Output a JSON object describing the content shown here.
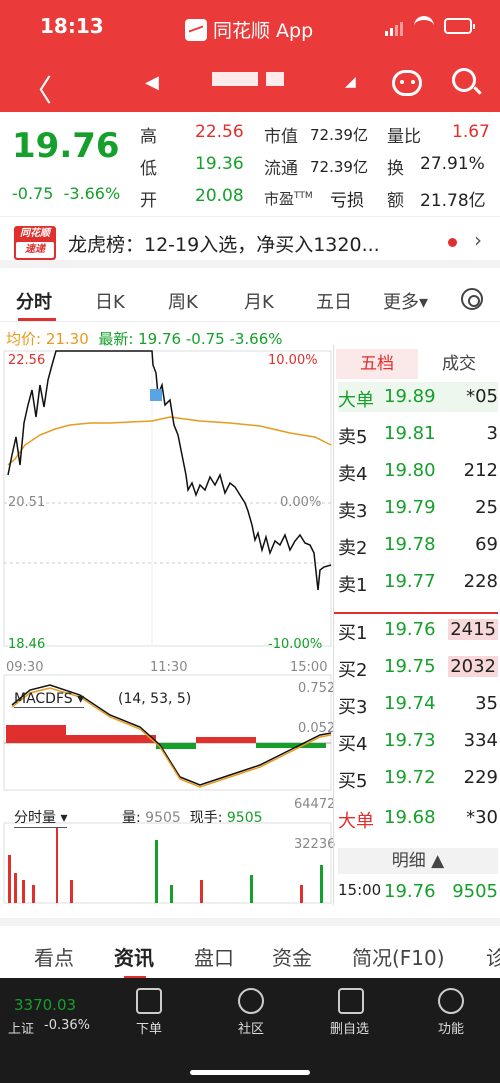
{
  "status": {
    "time": "18:13",
    "app": "同花顺 App"
  },
  "nav": {
    "back": "〈",
    "search": "search"
  },
  "quote": {
    "price": "19.76",
    "change": "-0.75",
    "pct": "-3.66%",
    "high_label": "高",
    "high": "22.56",
    "low_label": "低",
    "low": "19.36",
    "open_label": "开",
    "open": "20.08",
    "mktcap_label": "市值",
    "mktcap": "72.39亿",
    "float_label": "流通",
    "float": "72.39亿",
    "pe_label": "市盈",
    "pe_sup": "TTM",
    "pe": "亏损",
    "vr_label": "量比",
    "vr": "1.67",
    "turn_label": "换",
    "turn": "27.91%",
    "amt_label": "额",
    "amt": "21.78亿"
  },
  "news": {
    "logo_top": "同花顺",
    "logo_bottom": "速递",
    "text": "龙虎榜：12-19入选，净买入1320...",
    "arrow": "›"
  },
  "tabs": [
    "分时",
    "日K",
    "周K",
    "月K",
    "五日",
    "更多▾"
  ],
  "chart": {
    "avg_label": "均价: 21.30",
    "latest_label": "最新: 19.76",
    "chg": "-0.75",
    "pct": "-3.66%",
    "y_high": "22.56",
    "y_mid": "20.51",
    "y_low": "18.46",
    "pct_high": "10.00%",
    "pct_mid": "0.00%",
    "pct_low": "-10.00%",
    "times": [
      "09:30",
      "11:30",
      "15:00"
    ],
    "macd_name": "MACDFS ▾",
    "macd_params": "(14, 53, 5)",
    "macd_top": "0.752",
    "macd_mid": "0.052",
    "vol_name": "分时量 ▾",
    "vol_label": "量:",
    "vol_value": "9505",
    "now_label": "现手:",
    "now_value": "9505",
    "vol_top": "64472",
    "vol_mid": "32236"
  },
  "orderbook": {
    "tab1": "五档",
    "tab2": "成交",
    "rows": [
      {
        "l": "大单",
        "p": "19.89",
        "v": "*05",
        "c": "green"
      },
      {
        "l": "卖5",
        "p": "19.81",
        "v": "3",
        "c": "green"
      },
      {
        "l": "卖4",
        "p": "19.80",
        "v": "212",
        "c": "green"
      },
      {
        "l": "卖3",
        "p": "19.79",
        "v": "25",
        "c": "green"
      },
      {
        "l": "卖2",
        "p": "19.78",
        "v": "69",
        "c": "green"
      },
      {
        "l": "卖1",
        "p": "19.77",
        "v": "228",
        "c": "green"
      },
      {
        "l": "买1",
        "p": "19.76",
        "v": "2415",
        "c": "green"
      },
      {
        "l": "买2",
        "p": "19.75",
        "v": "2032",
        "c": "green"
      },
      {
        "l": "买3",
        "p": "19.74",
        "v": "35",
        "c": "green"
      },
      {
        "l": "买4",
        "p": "19.73",
        "v": "334",
        "c": "green"
      },
      {
        "l": "买5",
        "p": "19.72",
        "v": "229",
        "c": "green"
      },
      {
        "l": "大单",
        "p": "19.68",
        "v": "*30",
        "c": "green"
      }
    ],
    "detail": "明细 ▲",
    "last": {
      "t": "15:00",
      "p": "19.76",
      "v": "9505"
    }
  },
  "bottom_tabs": [
    "看点",
    "资讯",
    "盘口",
    "资金",
    "简况(F10)",
    "诊"
  ],
  "dock": {
    "index_value": "3370.03",
    "index_name": "上证",
    "index_pct": "-0.36%",
    "items": [
      "下单",
      "社区",
      "删自选",
      "功能"
    ]
  }
}
